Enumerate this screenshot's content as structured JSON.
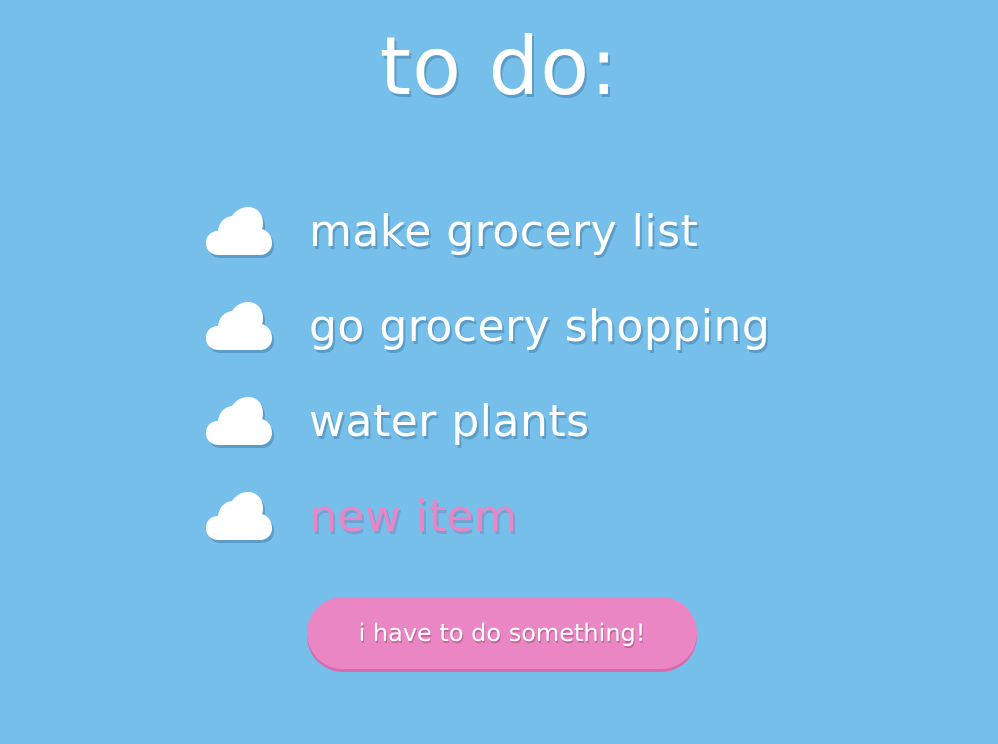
{
  "colors": {
    "background": "#76bfea",
    "text": "#ffffff",
    "accent_pink": "#ea86c4"
  },
  "header": {
    "title": "to do:"
  },
  "todos": [
    {
      "icon": "cloud-icon",
      "text": "make grocery list"
    },
    {
      "icon": "cloud-icon",
      "text": "go grocery shopping"
    },
    {
      "icon": "cloud-icon",
      "text": "water plants"
    }
  ],
  "new_item": {
    "icon": "cloud-icon",
    "placeholder": "new item",
    "value": ""
  },
  "add_button": {
    "label": "i have to do something!"
  }
}
